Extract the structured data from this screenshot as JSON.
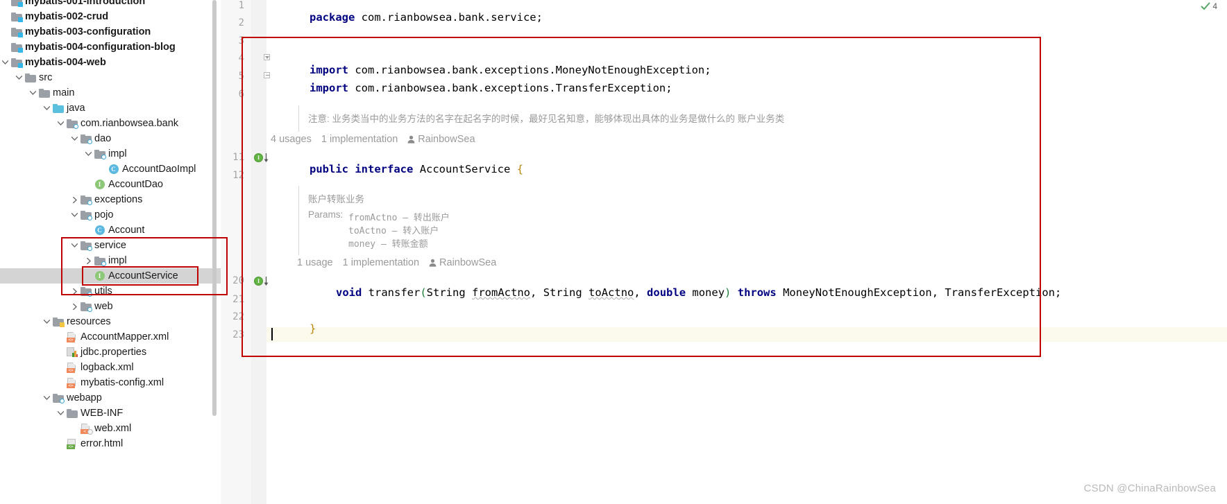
{
  "tree": {
    "rows": [
      {
        "depth": 0,
        "twisty": "",
        "icon": "module-folder-icon",
        "label": "mybatis-001-introduction",
        "bold": true,
        "selected": false,
        "clipped_top": true
      },
      {
        "depth": 0,
        "twisty": "",
        "icon": "module-folder-icon",
        "label": "mybatis-002-crud",
        "bold": true,
        "selected": false
      },
      {
        "depth": 0,
        "twisty": "",
        "icon": "module-folder-icon",
        "label": "mybatis-003-configuration",
        "bold": true,
        "selected": false
      },
      {
        "depth": 0,
        "twisty": "",
        "icon": "module-folder-icon",
        "label": "mybatis-004-configuration-blog",
        "bold": true,
        "selected": false
      },
      {
        "depth": 0,
        "twisty": "down",
        "icon": "module-folder-icon",
        "label": "mybatis-004-web",
        "bold": true,
        "selected": false
      },
      {
        "depth": 1,
        "twisty": "down",
        "icon": "source-folder-icon",
        "label": "src",
        "bold": false,
        "selected": false
      },
      {
        "depth": 2,
        "twisty": "down",
        "icon": "folder-icon",
        "label": "main",
        "bold": false,
        "selected": false
      },
      {
        "depth": 3,
        "twisty": "down",
        "icon": "java-source-folder-icon",
        "label": "java",
        "bold": false,
        "selected": false
      },
      {
        "depth": 4,
        "twisty": "down",
        "icon": "package-icon",
        "label": "com.rianbowsea.bank",
        "bold": false,
        "selected": false
      },
      {
        "depth": 5,
        "twisty": "down",
        "icon": "package-icon",
        "label": "dao",
        "bold": false,
        "selected": false
      },
      {
        "depth": 6,
        "twisty": "down",
        "icon": "package-icon",
        "label": "impl",
        "bold": false,
        "selected": false
      },
      {
        "depth": 7,
        "twisty": "",
        "icon": "class-icon",
        "label": "AccountDaoImpl",
        "bold": false,
        "selected": false
      },
      {
        "depth": 6,
        "twisty": "",
        "icon": "interface-icon",
        "label": "AccountDao",
        "bold": false,
        "selected": false
      },
      {
        "depth": 5,
        "twisty": "right",
        "icon": "package-icon",
        "label": "exceptions",
        "bold": false,
        "selected": false
      },
      {
        "depth": 5,
        "twisty": "down",
        "icon": "package-icon",
        "label": "pojo",
        "bold": false,
        "selected": false
      },
      {
        "depth": 6,
        "twisty": "",
        "icon": "class-icon",
        "label": "Account",
        "bold": false,
        "selected": false
      },
      {
        "depth": 5,
        "twisty": "down",
        "icon": "package-icon",
        "label": "service",
        "bold": false,
        "selected": false
      },
      {
        "depth": 6,
        "twisty": "right",
        "icon": "package-icon",
        "label": "impl",
        "bold": false,
        "selected": false
      },
      {
        "depth": 6,
        "twisty": "",
        "icon": "interface-icon",
        "label": "AccountService",
        "bold": false,
        "selected": true
      },
      {
        "depth": 5,
        "twisty": "right",
        "icon": "package-icon",
        "label": "utils",
        "bold": false,
        "selected": false
      },
      {
        "depth": 5,
        "twisty": "right",
        "icon": "package-icon",
        "label": "web",
        "bold": false,
        "selected": false
      },
      {
        "depth": 3,
        "twisty": "down",
        "icon": "resources-folder-icon",
        "label": "resources",
        "bold": false,
        "selected": false
      },
      {
        "depth": 4,
        "twisty": "",
        "icon": "xml-file-icon",
        "label": "AccountMapper.xml",
        "bold": false,
        "selected": false
      },
      {
        "depth": 4,
        "twisty": "",
        "icon": "properties-file-icon",
        "label": "jdbc.properties",
        "bold": false,
        "selected": false
      },
      {
        "depth": 4,
        "twisty": "",
        "icon": "xml-file-icon",
        "label": "logback.xml",
        "bold": false,
        "selected": false
      },
      {
        "depth": 4,
        "twisty": "",
        "icon": "xml-file-icon",
        "label": "mybatis-config.xml",
        "bold": false,
        "selected": false
      },
      {
        "depth": 3,
        "twisty": "down",
        "icon": "webapp-folder-icon",
        "label": "webapp",
        "bold": false,
        "selected": false
      },
      {
        "depth": 4,
        "twisty": "down",
        "icon": "folder-icon",
        "label": "WEB-INF",
        "bold": false,
        "selected": false
      },
      {
        "depth": 5,
        "twisty": "",
        "icon": "web-xml-file-icon",
        "label": "web.xml",
        "bold": false,
        "selected": false
      },
      {
        "depth": 4,
        "twisty": "",
        "icon": "html-file-icon",
        "label": "error.html",
        "bold": false,
        "selected": false,
        "clipped_bottom": true
      }
    ]
  },
  "editor": {
    "line_numbers": [
      "1",
      "2",
      "3",
      "4",
      "5",
      "6",
      "11",
      "12",
      "20",
      "21",
      "22",
      "23"
    ],
    "code": {
      "l1_kw": "package",
      "l1_rest": " com.rianbowsea.bank.service;",
      "l4_kw": "import",
      "l4_rest": " com.rianbowsea.bank.exceptions.MoneyNotEnoughException;",
      "l5_kw": "import",
      "l5_rest": " com.rianbowsea.bank.exceptions.TransferException;",
      "l11_kw1": "public",
      "l11_kw2": "interface",
      "l11_name": "AccountService",
      "l11_brace": "{",
      "l20_kw_void": "void",
      "l20_name": "transfer",
      "l20_p_open": "(",
      "l20_t1": "String",
      "l20_a1": "fromActno",
      "l20_sep1": ", ",
      "l20_t2": "String",
      "l20_a2": "toActno",
      "l20_sep2": ", ",
      "l20_kw_double": "double",
      "l20_a3": "money",
      "l20_p_close": ")",
      "l20_kw_throws": "throws",
      "l20_ex1": "MoneyNotEnoughException",
      "l20_sep3": ", ",
      "l20_ex2": "TransferException",
      "l20_semi": ";",
      "l22_brace": "}"
    },
    "class_doc": {
      "text": "注意: 业务类当中的业务方法的名字在起名字的时候，最好见名知意，能够体现出具体的业务是做什么的 账户业务类"
    },
    "class_codevision": {
      "usages": "4 usages",
      "implementations": "1 implementation",
      "author": "RainbowSea"
    },
    "method_doc": {
      "summary": "账户转账业务",
      "params_label": "Params:",
      "params": [
        "fromActno – 转出账户",
        "toActno – 转入账户",
        "money – 转账金额"
      ]
    },
    "method_codevision": {
      "usages": "1 usage",
      "implementations": "1 implementation",
      "author": "RainbowSea"
    },
    "inspection": {
      "status": "no-problems-check-icon",
      "count": "4"
    }
  },
  "annotations": {
    "box_code_region": "red-highlight-code-region",
    "box_service_package": "red-highlight-service-package",
    "box_account_service": "red-highlight-account-service-file"
  },
  "watermark": "CSDN @ChinaRainbowSea",
  "colors": {
    "keyword": "#000080",
    "annotation_red": "#c00000",
    "selection_grey": "#d4d4d4",
    "inlay_grey": "#9a9a9a",
    "interface_green": "#62b543",
    "class_blue": "#5bb8e0",
    "current_line": "#fcfaec"
  }
}
